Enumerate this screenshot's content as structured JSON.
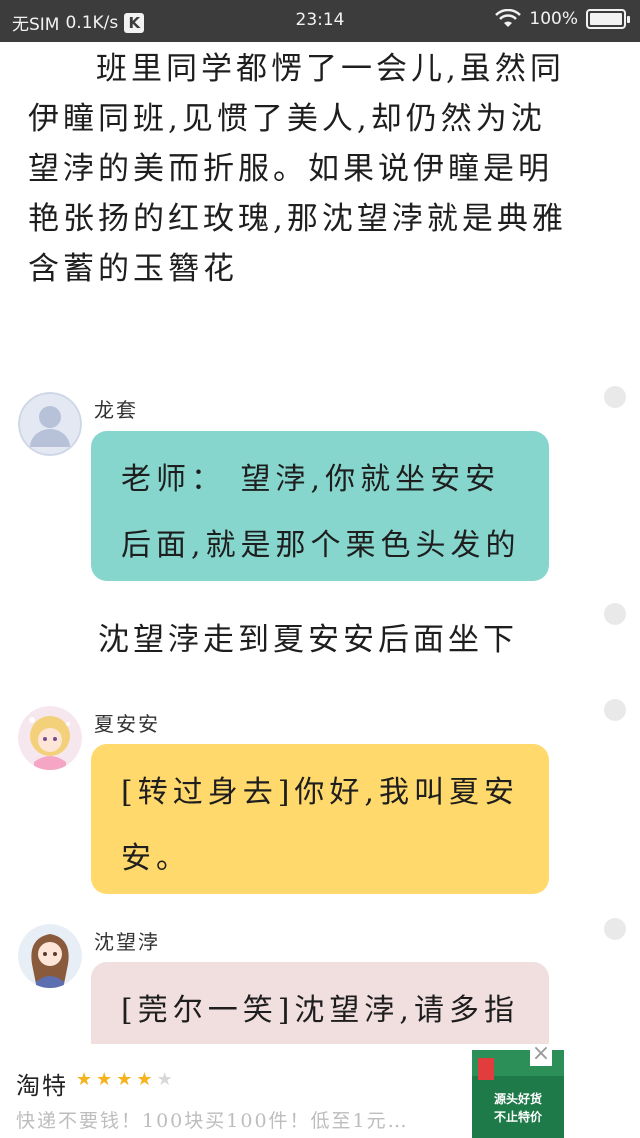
{
  "status_bar": {
    "carrier": "无SIM",
    "net_speed": "0.1K/s",
    "app_badge": "K",
    "time": "23:14",
    "battery_text": "100%",
    "battery_level": 1.0
  },
  "story": {
    "paragraph_1": "班里同学都愣了一会儿,虽然同伊瞳同班,见惯了美人,却仍然为沈望浡的美而折服。如果说伊瞳是明艳张扬的红玫瑰,那沈望浡就是典雅含蓄的玉簪花",
    "paragraph_2": "沈望浡走到夏安安后面坐下"
  },
  "messages": [
    {
      "speaker": "龙套",
      "text": "老师： 望浡,你就坐安安后面,就是那个栗色头发的",
      "bubble_color": "#86d6cd",
      "avatar": "default-user-avatar"
    },
    {
      "speaker": "夏安安",
      "text": "[转过身去]你好,我叫夏安安。",
      "bubble_color": "#ffd96b",
      "avatar": "anime-girl-avatar"
    },
    {
      "speaker": "沈望浡",
      "text": "[莞尔一笑]沈望浡,请多指",
      "bubble_color": "#f1dfe0",
      "avatar": "anime-girl-avatar"
    }
  ],
  "ad": {
    "title": "淘特",
    "rating": 4,
    "rating_max": 5,
    "description": "快递不要钱！100块买100件！低至1元…",
    "image_line_1": "源头好货",
    "image_line_2": "不止特价",
    "close_icon": "close-icon"
  }
}
